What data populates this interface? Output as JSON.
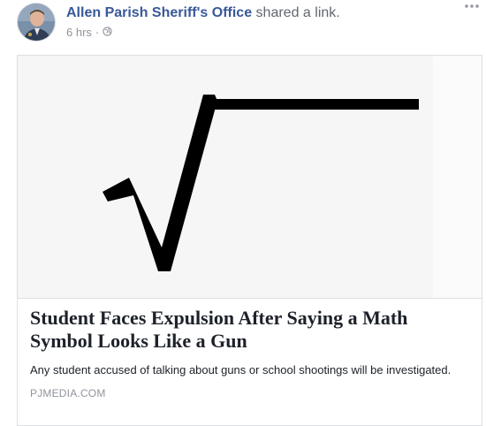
{
  "post": {
    "page_name": "Allen Parish Sheriff's Office",
    "action": "shared a link.",
    "time": "6 hrs",
    "separator": "·",
    "privacy_icon": "globe-icon",
    "menu_icon": "more-options-icon"
  },
  "link_preview": {
    "image_symbol": "square-root-symbol",
    "title": "Student Faces Expulsion After Saying a Math Symbol Looks Like a Gun",
    "description": "Any student accused of talking about guns or school shootings will be investigated.",
    "domain": "PJMEDIA.COM"
  },
  "colors": {
    "link_blue": "#385898",
    "meta_gray": "#90949c",
    "text_dark": "#1d2129",
    "border": "#dddfe2"
  }
}
